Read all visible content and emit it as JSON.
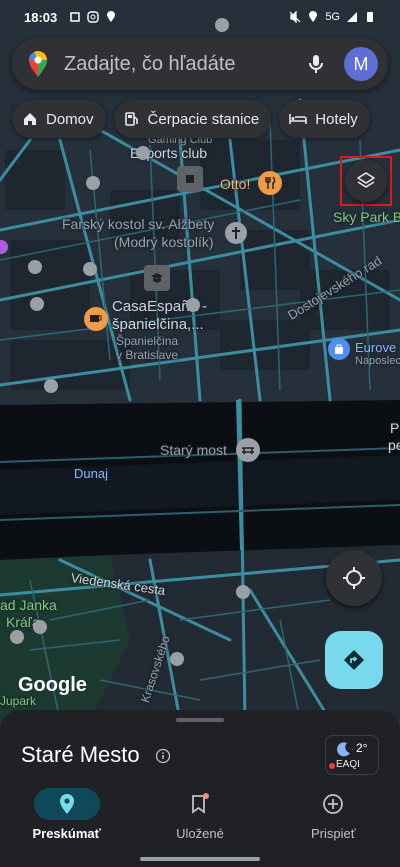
{
  "status_bar": {
    "time": "18:03",
    "network": "5G"
  },
  "search": {
    "placeholder": "Zadajte, čo hľadáte",
    "avatar_letter": "M"
  },
  "chips": [
    {
      "label": "Domov",
      "icon": "home-icon"
    },
    {
      "label": "Čerpacie stanice",
      "icon": "gas-station-icon"
    },
    {
      "label": "Hotely",
      "icon": "bed-icon"
    }
  ],
  "map_labels": {
    "gaming_club": "Gaming Club",
    "esports_club": "Esports club",
    "otto": "Otto!",
    "sky_park": "Sky Park B",
    "church_line1": "Farský kostol sv. Alžbety",
    "church_line2": "(Modrý kostolík)",
    "dostojevskeho": "Dostojevského rad",
    "casa_line1": "CasaEspaña -",
    "casa_line2": "španielčina,...",
    "casa_sub1": "Španielčina",
    "casa_sub2": "v Bratislave",
    "eurovea_line1": "Eurove",
    "eurovea_line2": "Naposlec",
    "stary_most": "Starý most",
    "dunaj": "Dunaj",
    "viedenska": "Viedenská cesta",
    "janka_line1": "ad Janka",
    "janka_line2": "Kráľa",
    "krasovskeho": "Krasovského",
    "jupark": "Jupark",
    "edge_p": "P",
    "edge_pe": "pe",
    "google": "Google"
  },
  "sheet": {
    "title": "Staré Mesto",
    "weather_temp": "2°",
    "weather_index": "EAQI"
  },
  "nav": [
    {
      "label": "Preskúmať",
      "icon": "explore-pin-icon",
      "active": true
    },
    {
      "label": "Uložené",
      "icon": "bookmark-icon",
      "active": false
    },
    {
      "label": "Prispieť",
      "icon": "add-circle-icon",
      "active": false
    }
  ],
  "colors": {
    "road": "#3f8fa1",
    "block": "#1f2933",
    "water": "#0c1014",
    "park": "#1d3a30",
    "accent_directions": "#78d9ec"
  }
}
